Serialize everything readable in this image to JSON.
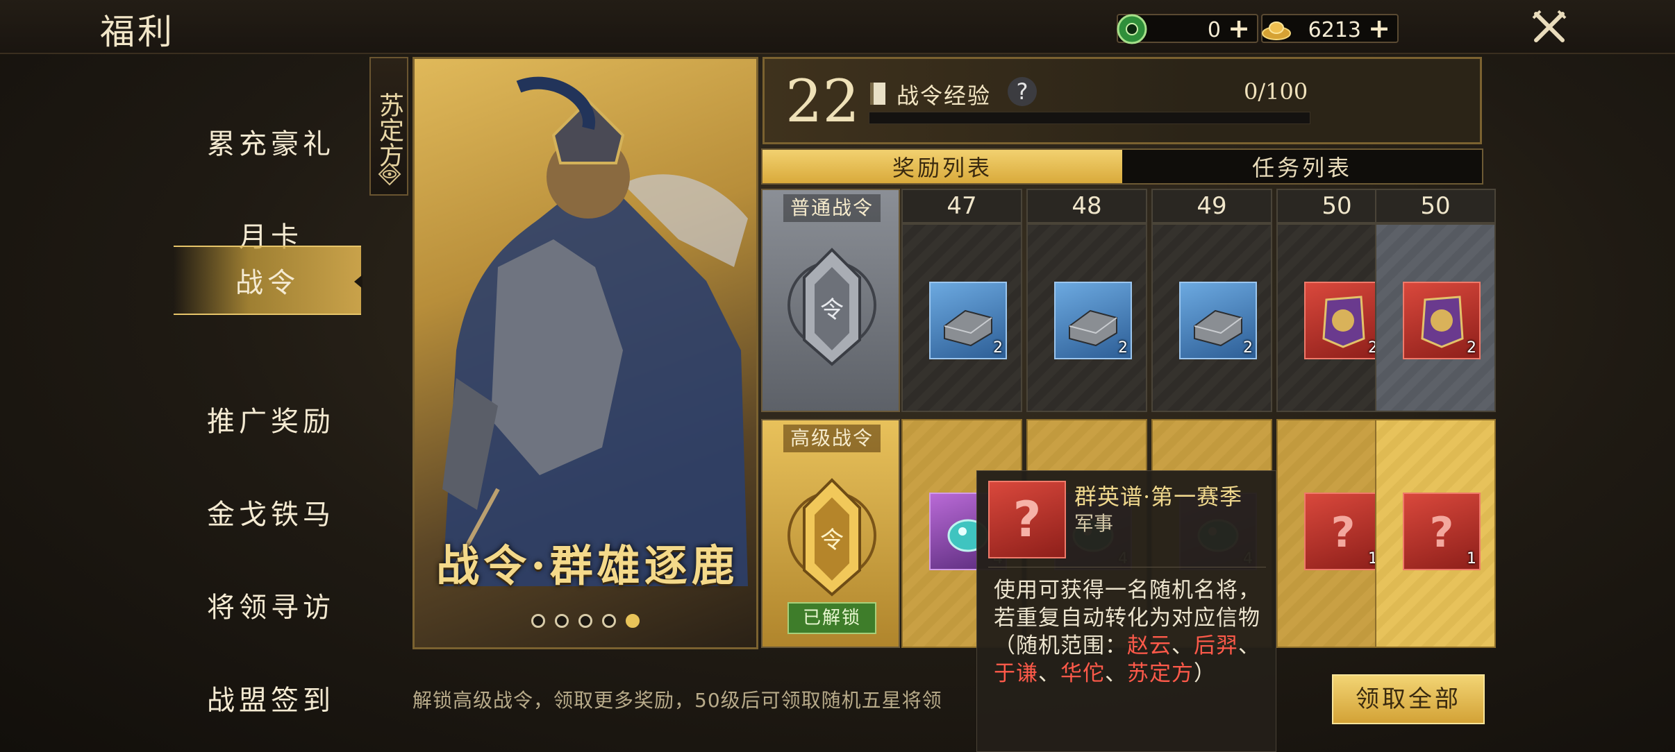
{
  "header": {
    "title": "福利",
    "currencies": [
      {
        "icon": "jade-coin-icon",
        "value": "0"
      },
      {
        "icon": "gold-ingot-icon",
        "value": "6213"
      }
    ]
  },
  "sidebar": {
    "items": [
      {
        "label": "累充豪礼"
      },
      {
        "label": "月卡"
      },
      {
        "label": "战令",
        "active": true
      },
      {
        "label": "推广奖励"
      },
      {
        "label": "金戈铁马"
      },
      {
        "label": "将领寻访"
      },
      {
        "label": "战盟签到"
      }
    ]
  },
  "hero": {
    "name": "苏定方",
    "title": "战令·群雄逐鹿",
    "page_count": 5,
    "active_page": 5
  },
  "battle_pass": {
    "level": "22",
    "exp_label": "战令经验",
    "exp_text": "0/100",
    "exp_fraction": 0.0
  },
  "tabs": [
    {
      "label": "奖励列表",
      "active": true
    },
    {
      "label": "任务列表",
      "active": false
    }
  ],
  "tracks": {
    "normal_label": "普通战令",
    "premium_label": "高级战令",
    "premium_status": "已解锁"
  },
  "levels": [
    {
      "level": "47",
      "normal": {
        "type": "blue",
        "qty": "2"
      },
      "premium": {
        "type": "purple",
        "qty": "4"
      }
    },
    {
      "level": "48",
      "normal": {
        "type": "blue",
        "qty": "2"
      },
      "premium": {
        "type": "purple",
        "qty": "4"
      }
    },
    {
      "level": "49",
      "normal": {
        "type": "blue",
        "qty": "2"
      },
      "premium": {
        "type": "purple",
        "qty": "4"
      }
    },
    {
      "level": "50",
      "normal": {
        "type": "red",
        "qty": "2"
      },
      "premium": {
        "type": "red",
        "qty": "1"
      }
    },
    {
      "level": "50",
      "normal": {
        "type": "red",
        "qty": "2"
      },
      "premium": {
        "type": "red",
        "qty": "1"
      }
    }
  ],
  "footer": {
    "note": "解锁高级战令，领取更多奖励，50级后可领取随机五星将领",
    "claim_all": "领取全部"
  },
  "tooltip": {
    "title": "群英谱·第一赛季",
    "subtitle": "军事",
    "desc_prefix": "使用可获得一名随机名将，若重复自动转化为对应信物（随机范围：",
    "names": [
      "赵云",
      "后羿",
      "于谦",
      "华佗",
      "苏定方"
    ],
    "separator": "、",
    "desc_suffix": "）"
  },
  "colors": {
    "accent_gold": "#d9aa3b",
    "unlocked_green": "#3e7d2a",
    "highlight_red": "#ff5a4a"
  }
}
